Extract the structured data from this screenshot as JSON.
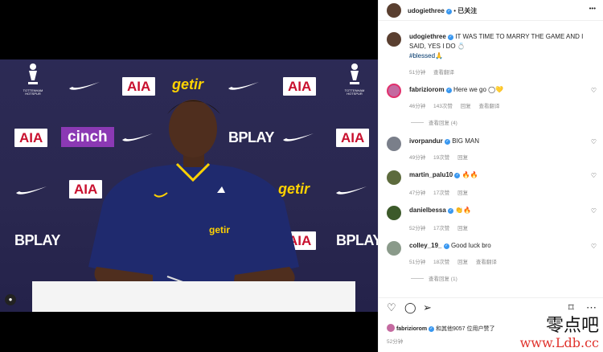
{
  "post": {
    "author": "udogiethree",
    "follow_status": "已关注",
    "more": "•••",
    "caption_user": "udogiethree",
    "caption_text": "IT WAS TIME TO MARRY THE GAME AND I SAID, YES I DO 💍",
    "hashtag": "#blessed🙏",
    "caption_time": "51分钟",
    "translate": "查看翻译"
  },
  "photo": {
    "sponsors": [
      "AIA",
      "getir",
      "cinch",
      "BPLAY"
    ],
    "club": "TOTTENHAM HOTSPUR",
    "shirt_sponsor": "getir"
  },
  "comments": [
    {
      "user": "fabriziorom",
      "verified": true,
      "text": "Here we go ◯💛",
      "time": "46分钟",
      "likes": "143次赞",
      "reply": "回复",
      "translate": "查看翻译",
      "view_replies": "查看回复 (4)"
    },
    {
      "user": "ivorpandur",
      "verified": true,
      "text": "BIG MAN",
      "time": "49分钟",
      "likes": "19次赞",
      "reply": "回复"
    },
    {
      "user": "martin_palu10",
      "verified": true,
      "text": "🔥🔥",
      "time": "47分钟",
      "likes": "17次赞",
      "reply": "回复"
    },
    {
      "user": "danielbessa",
      "verified": true,
      "text": "👏🔥",
      "time": "52分钟",
      "likes": "17次赞",
      "reply": "回复"
    },
    {
      "user": "colley_19_",
      "verified": true,
      "text": "Good luck bro",
      "time": "51分钟",
      "likes": "18次赞",
      "reply": "回复",
      "translate": "查看翻译",
      "view_replies": "查看回复 (1)"
    }
  ],
  "footer": {
    "liked_user": "fabriziorom",
    "liked_text": "和其他9057 位用户赞了",
    "time": "52分钟"
  },
  "watermark": {
    "title": "零点吧",
    "url": "www.Ldb.cc"
  }
}
